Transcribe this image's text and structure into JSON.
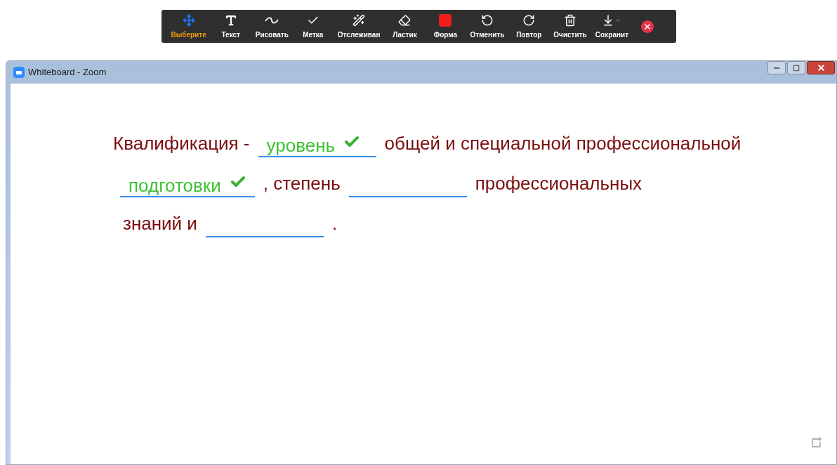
{
  "toolbar": {
    "tools": [
      {
        "label": "Выберите",
        "kind": "select",
        "selected": true
      },
      {
        "label": "Текст",
        "kind": "text",
        "selected": false
      },
      {
        "label": "Рисовать",
        "kind": "draw",
        "selected": false
      },
      {
        "label": "Метка",
        "kind": "stamp",
        "selected": false
      },
      {
        "label": "Отслеживан",
        "kind": "spotlight",
        "selected": false
      },
      {
        "label": "Ластик",
        "kind": "eraser",
        "selected": false
      },
      {
        "label": "Форма",
        "kind": "format",
        "selected": false,
        "color": "#f01e1e"
      },
      {
        "label": "Отменить",
        "kind": "undo",
        "selected": false
      },
      {
        "label": "Повтор",
        "kind": "redo",
        "selected": false
      },
      {
        "label": "Очистить",
        "kind": "clear",
        "selected": false
      },
      {
        "label": "Сохранит",
        "kind": "save",
        "selected": false
      }
    ]
  },
  "window": {
    "title": "Whiteboard - Zoom"
  },
  "whiteboard": {
    "lines": [
      [
        {
          "kind": "text",
          "text": "Квалификация -"
        },
        {
          "kind": "blank",
          "answer": "уровень",
          "correct": true
        },
        {
          "kind": "text",
          "text": "общей и специальной профессиональной"
        }
      ],
      [
        {
          "kind": "blank",
          "answer": "подготовки",
          "correct": true
        },
        {
          "kind": "text",
          "text": ", степень"
        },
        {
          "kind": "blank",
          "correct": false
        },
        {
          "kind": "text",
          "text": "профессиональных"
        }
      ],
      [
        {
          "kind": "text",
          "text": "знаний и"
        },
        {
          "kind": "blank",
          "correct": false
        },
        {
          "kind": "text",
          "text": "."
        }
      ]
    ]
  }
}
